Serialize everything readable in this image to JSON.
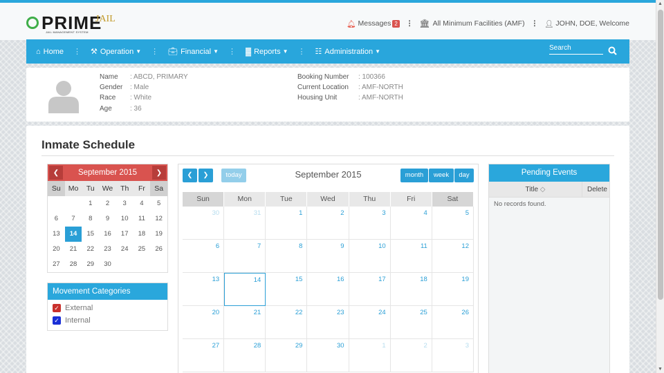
{
  "app": {
    "logo_name": "PRIME",
    "logo_suffix": "JAIL",
    "logo_tagline": "JAIL MANAGEMENT SYSTEM"
  },
  "topbar": {
    "messages_label": "Messages",
    "messages_count": "2",
    "facility_label": "All Minimum Facilities (AMF)",
    "user_label": "JOHN, DOE, Welcome"
  },
  "nav": {
    "items": [
      {
        "label": "Home",
        "icon": "home-icon"
      },
      {
        "label": "Operation",
        "icon": "gavel-icon"
      },
      {
        "label": "Financial",
        "icon": "briefcase-icon"
      },
      {
        "label": "Reports",
        "icon": "bar-chart-icon"
      },
      {
        "label": "Administration",
        "icon": "sitemap-icon"
      }
    ],
    "search_placeholder": "Search"
  },
  "inmate": {
    "name_label": "Name",
    "name": ": ABCD, PRIMARY",
    "gender_label": "Gender",
    "gender": ": Male",
    "race_label": "Race",
    "race": ": White",
    "age_label": "Age",
    "age": ": 36",
    "booking_label": "Booking Number",
    "booking": ": 100366",
    "location_label": "Current Location",
    "location": ": AMF-NORTH",
    "housing_label": "Housing Unit",
    "housing": ": AMF-NORTH"
  },
  "page": {
    "title": "Inmate Schedule"
  },
  "mini_calendar": {
    "month_label": "September 2015",
    "day_names": [
      "Su",
      "Mo",
      "Tu",
      "We",
      "Th",
      "Fr",
      "Sa"
    ],
    "days": [
      "",
      "",
      "1",
      "2",
      "3",
      "4",
      "5",
      "6",
      "7",
      "8",
      "9",
      "10",
      "11",
      "12",
      "13",
      "14",
      "15",
      "16",
      "17",
      "18",
      "19",
      "20",
      "21",
      "22",
      "23",
      "24",
      "25",
      "26",
      "27",
      "28",
      "29",
      "30",
      "",
      "",
      ""
    ],
    "selected": "14"
  },
  "movement": {
    "title": "Movement Categories",
    "items": [
      {
        "label": "External",
        "color": "#c9302c"
      },
      {
        "label": "Internal",
        "color": "#1a2fd6"
      }
    ]
  },
  "calendar": {
    "title": "September 2015",
    "today_label": "today",
    "view_month": "month",
    "view_week": "week",
    "view_day": "day",
    "day_names": [
      "Sun",
      "Mon",
      "Tue",
      "Wed",
      "Thu",
      "Fri",
      "Sat"
    ],
    "cells": [
      {
        "d": "30",
        "other": true
      },
      {
        "d": "31",
        "other": true
      },
      {
        "d": "1"
      },
      {
        "d": "2"
      },
      {
        "d": "3"
      },
      {
        "d": "4"
      },
      {
        "d": "5"
      },
      {
        "d": "6"
      },
      {
        "d": "7"
      },
      {
        "d": "8"
      },
      {
        "d": "9"
      },
      {
        "d": "10"
      },
      {
        "d": "11"
      },
      {
        "d": "12"
      },
      {
        "d": "13"
      },
      {
        "d": "14",
        "today": true
      },
      {
        "d": "15"
      },
      {
        "d": "16"
      },
      {
        "d": "17"
      },
      {
        "d": "18"
      },
      {
        "d": "19"
      },
      {
        "d": "20"
      },
      {
        "d": "21"
      },
      {
        "d": "22"
      },
      {
        "d": "23"
      },
      {
        "d": "24"
      },
      {
        "d": "25"
      },
      {
        "d": "26"
      },
      {
        "d": "27"
      },
      {
        "d": "28"
      },
      {
        "d": "29"
      },
      {
        "d": "30"
      },
      {
        "d": "1",
        "other": true
      },
      {
        "d": "2",
        "other": true
      },
      {
        "d": "3",
        "other": true
      }
    ]
  },
  "pending": {
    "title": "Pending Events",
    "col_title": "Title",
    "col_delete": "Delete",
    "empty": "No records found."
  }
}
